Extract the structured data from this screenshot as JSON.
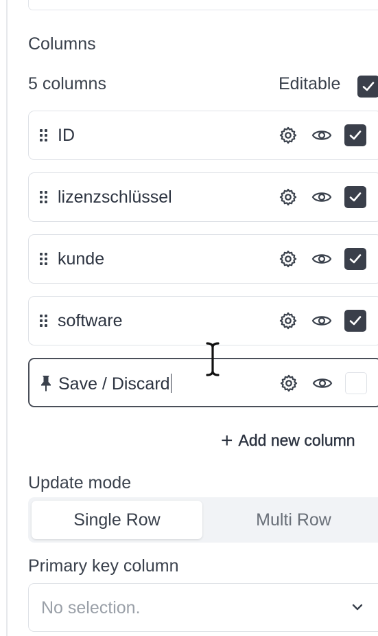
{
  "panel": {
    "section_title": "Columns",
    "column_count_label": "5 columns",
    "editable_label": "Editable",
    "editable_checked": true
  },
  "columns": [
    {
      "name": "ID",
      "handle_icon": "drag-handle-icon",
      "visible": true,
      "editable": true
    },
    {
      "name": "lizenzschlüssel",
      "handle_icon": "drag-handle-icon",
      "visible": true,
      "editable": true
    },
    {
      "name": "kunde",
      "handle_icon": "drag-handle-icon",
      "visible": true,
      "editable": true
    },
    {
      "name": "software",
      "handle_icon": "drag-handle-icon",
      "visible": true,
      "editable": true
    },
    {
      "name": "Save / Discard",
      "handle_icon": "pin-icon",
      "visible": true,
      "editable": false
    }
  ],
  "add_column": {
    "label": "Add new column",
    "icon": "plus-icon"
  },
  "update_mode": {
    "label": "Update mode",
    "options": [
      "Single Row",
      "Multi Row"
    ],
    "selected": "Single Row"
  },
  "primary_key": {
    "label": "Primary key column",
    "placeholder": "No selection.",
    "icon": "chevron-down-icon"
  },
  "colors": {
    "checkbox_fill": "#3a3f4a",
    "text": "#2c3340",
    "border": "#dfe2e7",
    "segment_bg": "#f1f3f6"
  }
}
